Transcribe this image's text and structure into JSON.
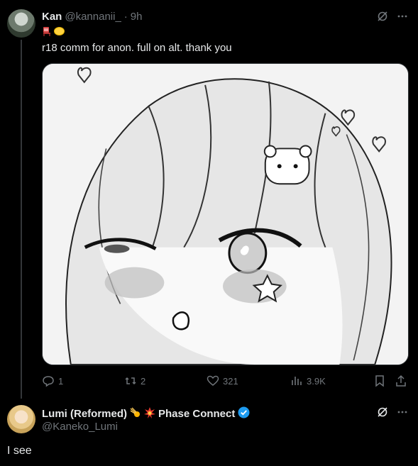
{
  "post": {
    "author_name": "Kan",
    "handle": "@kannanii_",
    "separator": "·",
    "time": "9h",
    "emojis": [
      "chair-emoji",
      "lemon-emoji"
    ],
    "text": "r18 comm for anon. full on alt. thank you",
    "media": {
      "kind": "grayscale anime illustration"
    },
    "actions": {
      "replies": "1",
      "reposts": "2",
      "likes": "321",
      "views": "3.9K"
    }
  },
  "reply": {
    "author_name": "Lumi (Reformed)",
    "name_suffix": "Phase Connect",
    "handle": "@Kaneko_Lumi",
    "text": "I see"
  },
  "colors": {
    "background": "#000000",
    "text": "#e7e9ea",
    "muted": "#71767b",
    "verified": "#1d9bf0"
  }
}
